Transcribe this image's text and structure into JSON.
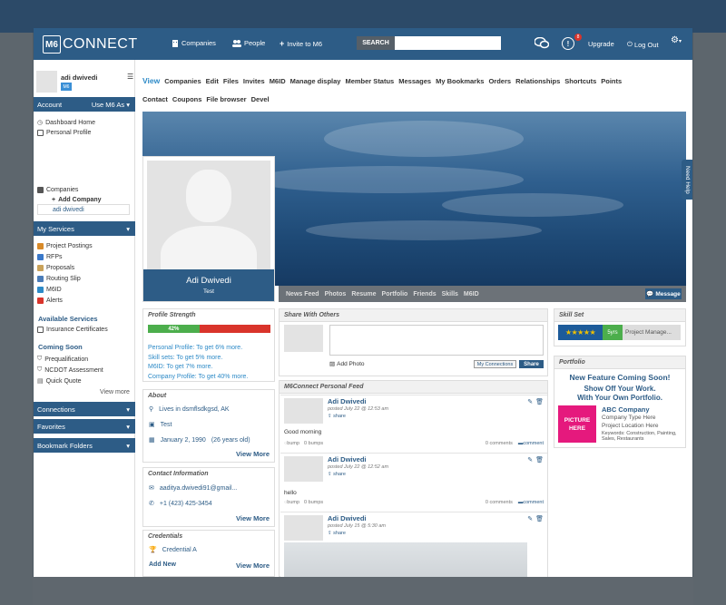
{
  "app": {
    "logo_mark": "M6",
    "logo_text": "CONNECT",
    "nav": {
      "companies": "Companies",
      "people": "People",
      "invite": "Invite to M6"
    },
    "search_button": "SEARCH",
    "search_placeholder": "",
    "alert_count": "8",
    "upgrade": "Upgrade",
    "logout": "Log Out"
  },
  "sidebar": {
    "user_name": "adi dwivedi",
    "user_tag": "M6",
    "account_label": "Account",
    "use_as_label": "Use M6 As",
    "account_items": [
      "Dashboard Home",
      "Personal Profile"
    ],
    "selected_profile": "adi dwivedi",
    "companies_label": "Companies",
    "add_company": "Add Company",
    "services_label": "My Services",
    "services": [
      "Project Postings",
      "RFPs",
      "Proposals",
      "Routing Slip",
      "M6ID",
      "Alerts"
    ],
    "available_label": "Available Services",
    "available": [
      "Insurance Certificates"
    ],
    "coming_label": "Coming Soon",
    "coming": [
      "Prequalification",
      "NCDOT Assessment",
      "Quick Quote"
    ],
    "view_more": "View more",
    "connections": "Connections",
    "favorites": "Favorites",
    "bookmark_folders": "Bookmark Folders"
  },
  "tabs": [
    "View",
    "Companies",
    "Edit",
    "Files",
    "Invites",
    "M6ID",
    "Manage display",
    "Member Status",
    "Messages",
    "My Bookmarks",
    "Orders",
    "Relationships",
    "Shortcuts",
    "Points",
    "Contact",
    "Coupons",
    "File browser",
    "Devel"
  ],
  "profile": {
    "name": "Adi Dwivedi",
    "title": "Test",
    "tabs": [
      "News Feed",
      "Photos",
      "Resume",
      "Portfolio",
      "Friends",
      "Skills",
      "M6ID"
    ],
    "message_button": "Message",
    "need_help": "Need Help"
  },
  "strength": {
    "title": "Profile Strength",
    "percent": 42,
    "percent_label": "42%",
    "tips": [
      "Personal Profile: To get 6% more.",
      "Skill sets: To get 5% more.",
      "M6ID: To get 7% more.",
      "Company Profile: To get 40% more."
    ]
  },
  "about": {
    "title": "About",
    "location": "Lives in dsmflsdkgsd, AK",
    "job": "Test",
    "birthday": "January 2, 1990",
    "age": "(26 years old)",
    "view_more": "View More"
  },
  "contact": {
    "title": "Contact Information",
    "email": "aaditya.dwivedi91@gmail...",
    "phone": "+1 (423) 425-3454",
    "view_more": "View More"
  },
  "credentials": {
    "title": "Credentials",
    "item": "Credential A",
    "add_new": "Add New",
    "view_more": "View More"
  },
  "share": {
    "title": "Share With Others",
    "placeholder": "",
    "add_photo": "Add Photo",
    "my_connections": "My Connections",
    "share_button": "Share"
  },
  "feed": {
    "title": "M6Connect Personal Feed",
    "posts": [
      {
        "author": "Adi Dwivedi",
        "date": "posted July 22 @ 12:53 am",
        "share": "share",
        "text": "Good morning",
        "bumps": "0 bumps",
        "bump": "bump",
        "comments": "0 comments",
        "comment": "comment"
      },
      {
        "author": "Adi Dwivedi",
        "date": "posted July 22 @ 12:52 am",
        "share": "share",
        "text": "hello",
        "bumps": "0 bumps",
        "bump": "bump",
        "comments": "0 comments",
        "comment": "comment"
      },
      {
        "author": "Adi Dwivedi",
        "date": "posted July 15 @ 5:30 am",
        "share": "share"
      }
    ]
  },
  "skills": {
    "title": "Skill Set",
    "stars": "★★★★★",
    "years": "5yrs",
    "name": "Project Manage..."
  },
  "portfolio": {
    "title": "Portfolio",
    "headline": "New Feature Coming Soon!",
    "sub1": "Show Off Your Work.",
    "sub2": "With Your Own Portfolio.",
    "picture": "PICTURE HERE",
    "company": "ABC Company",
    "type": "Company Type Here",
    "location": "Project Location Here",
    "keywords": "Keywords: Construction, Painting, Sales, Restaurants"
  },
  "colors": {
    "brand": "#2d5c86",
    "accent": "#2d8ac7",
    "progress_good": "#4cae4c",
    "progress_bad": "#d9342b",
    "pink": "#e5197d"
  }
}
